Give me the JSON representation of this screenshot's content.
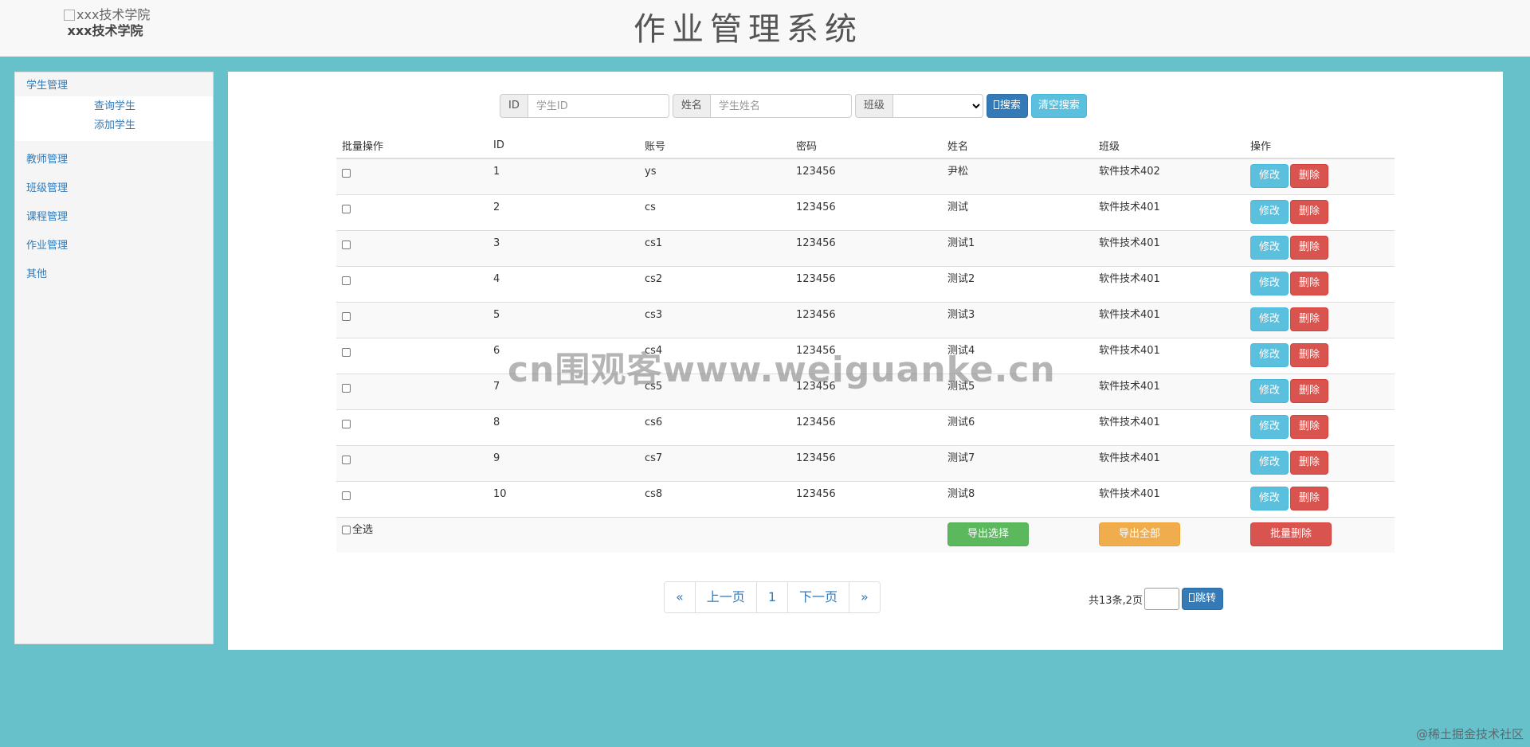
{
  "header": {
    "logo_alt": "xxx技术学院",
    "logo_name": "xxx技术学院",
    "title": "作业管理系统"
  },
  "sidebar": {
    "groups": [
      {
        "label": "学生管理",
        "items": [
          "查询学生",
          "添加学生"
        ]
      },
      {
        "label": "教师管理"
      },
      {
        "label": "班级管理"
      },
      {
        "label": "课程管理"
      },
      {
        "label": "作业管理"
      },
      {
        "label": "其他"
      }
    ]
  },
  "search": {
    "id_label": "ID",
    "id_placeholder": "学生ID",
    "name_label": "姓名",
    "name_placeholder": "学生姓名",
    "class_label": "班级",
    "class_selected": "",
    "search_btn": "搜索",
    "clear_btn": "清空搜索"
  },
  "table": {
    "headers": [
      "批量操作",
      "ID",
      "账号",
      "密码",
      "姓名",
      "班级",
      "操作"
    ],
    "rows": [
      {
        "id": "1",
        "account": "ys",
        "password": "123456",
        "name": "尹松",
        "class": "软件技术402"
      },
      {
        "id": "2",
        "account": "cs",
        "password": "123456",
        "name": "测试",
        "class": "软件技术401"
      },
      {
        "id": "3",
        "account": "cs1",
        "password": "123456",
        "name": "测试1",
        "class": "软件技术401"
      },
      {
        "id": "4",
        "account": "cs2",
        "password": "123456",
        "name": "测试2",
        "class": "软件技术401"
      },
      {
        "id": "5",
        "account": "cs3",
        "password": "123456",
        "name": "测试3",
        "class": "软件技术401"
      },
      {
        "id": "6",
        "account": "cs4",
        "password": "123456",
        "name": "测试4",
        "class": "软件技术401"
      },
      {
        "id": "7",
        "account": "cs5",
        "password": "123456",
        "name": "测试5",
        "class": "软件技术401"
      },
      {
        "id": "8",
        "account": "cs6",
        "password": "123456",
        "name": "测试6",
        "class": "软件技术401"
      },
      {
        "id": "9",
        "account": "cs7",
        "password": "123456",
        "name": "测试7",
        "class": "软件技术401"
      },
      {
        "id": "10",
        "account": "cs8",
        "password": "123456",
        "name": "测试8",
        "class": "软件技术401"
      }
    ],
    "edit_label": "修改",
    "delete_label": "删除",
    "select_all": "全选",
    "export_selected": "导出选择",
    "export_all": "导出全部",
    "batch_delete": "批量删除"
  },
  "pagination": {
    "first": "«",
    "prev": "上一页",
    "page": "1",
    "next": "下一页",
    "last": "»",
    "info": "共13条,2页",
    "jump_btn": "跳转"
  },
  "watermark": "cn围观客www.weiguanke.cn",
  "corner_text": "@稀土掘金技术社区"
}
